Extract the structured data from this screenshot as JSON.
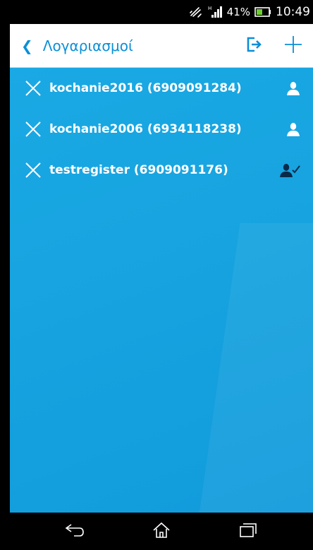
{
  "status_bar": {
    "vibrate_icon": "vibrate-icon",
    "signal_icon": "signal-icon",
    "battery_text": "41%",
    "battery_icon": "battery-icon",
    "time": "10:49"
  },
  "header": {
    "back_icon": "chevron-left-icon",
    "back_glyph": "❮",
    "title": "Λογαριασμοί",
    "logout_icon": "logout-icon",
    "add_icon": "plus-icon",
    "accent_color": "#0a8fd6"
  },
  "accounts": [
    {
      "label": "kochanie2016 (6909091284)",
      "status_icon": "user-icon",
      "active": false
    },
    {
      "label": "kochanie2006 (6934118238)",
      "status_icon": "user-icon",
      "active": false
    },
    {
      "label": "testregister (6909091176)",
      "status_icon": "user-check-icon",
      "active": true
    }
  ],
  "nav": {
    "back_icon": "back-arrow-icon",
    "home_icon": "home-icon",
    "recents_icon": "recents-icon"
  },
  "colors": {
    "list_background": "#17a4e0",
    "active_user_icon": "#0a2a4a"
  }
}
